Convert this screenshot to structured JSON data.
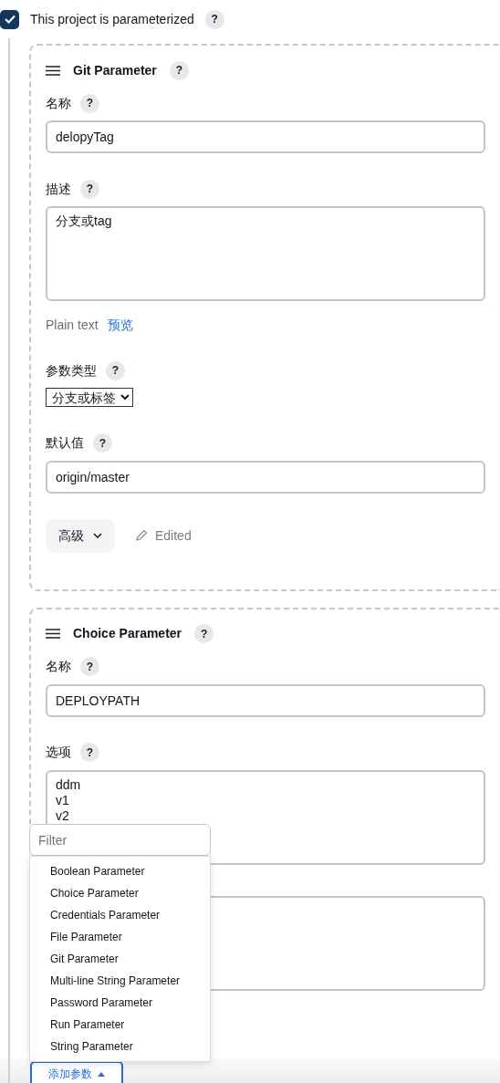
{
  "parameterized": {
    "label": "This project is parameterized",
    "checked": true,
    "help": "?"
  },
  "parameters": [
    {
      "title": "Git Parameter",
      "help": "?",
      "fields": [
        {
          "kind": "input",
          "label": "名称",
          "help": "?",
          "value": "delopyTag"
        },
        {
          "kind": "textarea",
          "label": "描述",
          "help": "?",
          "value": "分支或tag",
          "format_note": "Plain text",
          "preview_link": "预览"
        },
        {
          "kind": "select",
          "label": "参数类型",
          "help": "?",
          "value": "分支或标签"
        },
        {
          "kind": "input",
          "label": "默认值",
          "help": "?",
          "value": "origin/master"
        }
      ],
      "advanced": {
        "label": "高级",
        "edited": "Edited"
      }
    },
    {
      "title": "Choice Parameter",
      "help": "?",
      "fields": [
        {
          "kind": "input",
          "label": "名称",
          "help": "?",
          "value": "DEPLOYPATH"
        },
        {
          "kind": "textarea",
          "label": "选项",
          "help": "?",
          "value": "ddm\nv1\nv2"
        },
        {
          "kind": "textarea"
        }
      ]
    }
  ],
  "add_menu": {
    "filter": {
      "placeholder": "Filter"
    },
    "items": [
      "Boolean Parameter",
      "Choice Parameter",
      "Credentials Parameter",
      "File Parameter",
      "Git Parameter",
      "Multi-line String Parameter",
      "Password Parameter",
      "Run Parameter",
      "String Parameter"
    ]
  },
  "add_button": {
    "label": "添加参数",
    "expanded": true
  }
}
